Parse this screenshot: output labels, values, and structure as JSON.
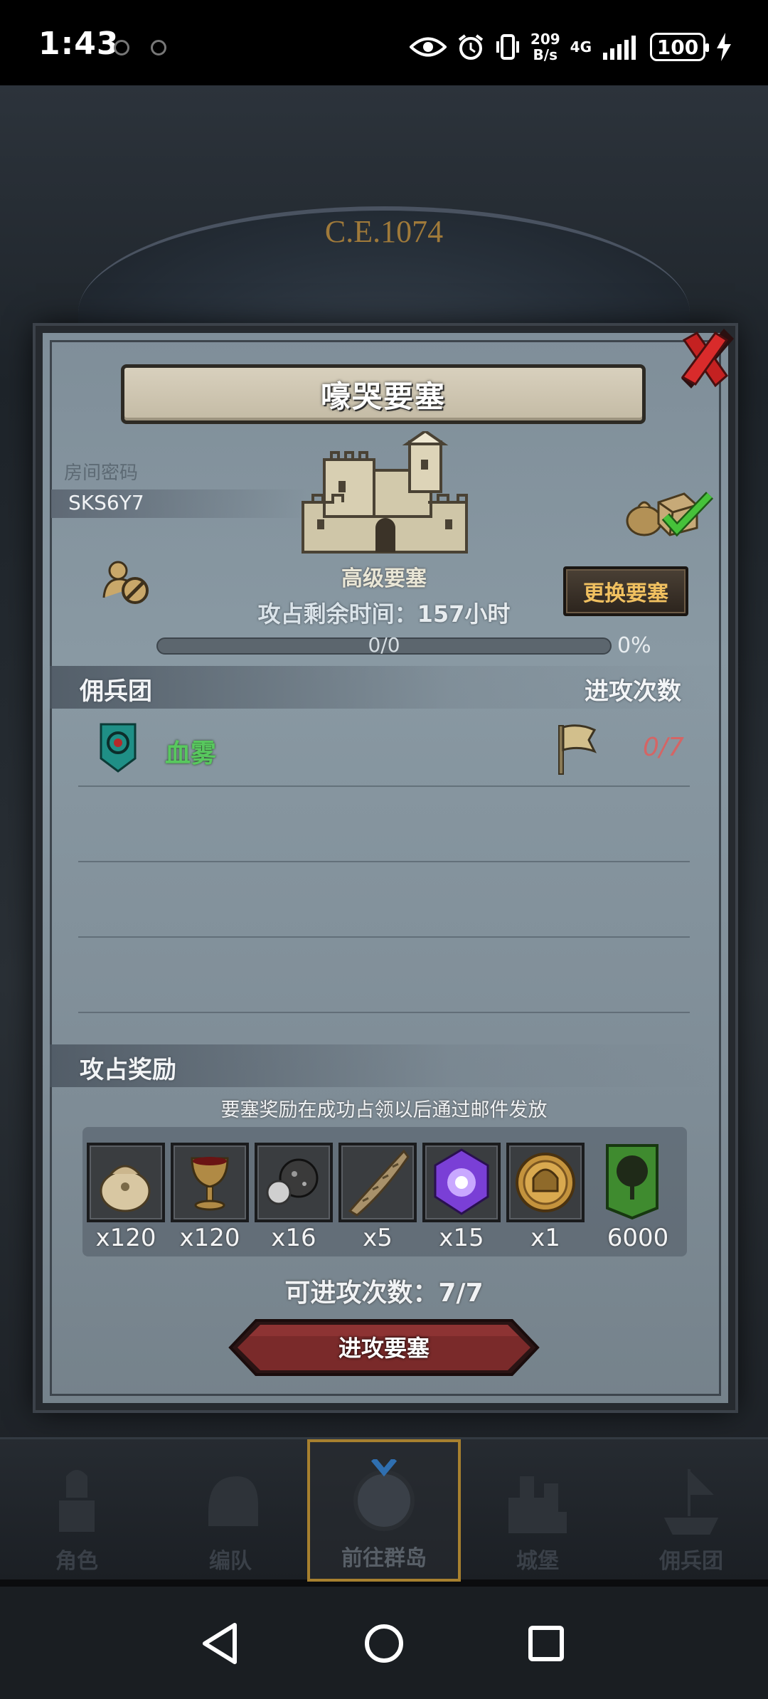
{
  "status_bar": {
    "time": "1:43",
    "net_speed_value": "209",
    "net_speed_unit": "B/s",
    "network": "4G",
    "battery": "100"
  },
  "background": {
    "year": "C.E.1074"
  },
  "dialog": {
    "title": "嚎哭要塞",
    "room_password_label": "房间密码",
    "room_password": "SKS6Y7",
    "fortress_level": "高级要塞",
    "change_fortress_label": "更换要塞",
    "occupy_time_label": "攻占剩余时间：",
    "occupy_time_value": "157",
    "occupy_time_unit": "小时",
    "progress_text": "0/0",
    "progress_percent_text": "0%",
    "progress_fraction": 0,
    "mercenary_section_label": "佣兵团",
    "attack_count_section_label": "进攻次数",
    "guilds": [
      {
        "name": "血雾",
        "attacks": "0/7"
      }
    ],
    "reward_section_label": "攻占奖励",
    "reward_note": "要塞奖励在成功占领以后通过邮件发放",
    "rewards": [
      {
        "icon": "sack-icon",
        "qty": "x120"
      },
      {
        "icon": "goblet-icon",
        "qty": "x120"
      },
      {
        "icon": "ore-icon",
        "qty": "x16"
      },
      {
        "icon": "horn-icon",
        "qty": "x5"
      },
      {
        "icon": "purple-crystal-icon",
        "qty": "x15"
      },
      {
        "icon": "helmet-coin-icon",
        "qty": "x1"
      },
      {
        "icon": "tree-banner-icon",
        "qty": "6000"
      }
    ],
    "attempts_label": "可进攻次数：",
    "attempts_value": "7/7",
    "attack_button_label": "进攻要塞"
  },
  "bottom_nav": {
    "items": [
      {
        "label": "角色",
        "icon": "knight-icon",
        "active": false
      },
      {
        "label": "编队",
        "icon": "helmet-icon",
        "active": false
      },
      {
        "label": "前往群岛",
        "icon": "globe-compass-icon",
        "active": true
      },
      {
        "label": "城堡",
        "icon": "castle-icon",
        "active": false
      },
      {
        "label": "佣兵团",
        "icon": "ship-icon",
        "active": false
      }
    ]
  },
  "colors": {
    "guild_name": "#58c85e",
    "attack_count": "#d46565",
    "change_button_text": "#f0c060",
    "accent_gold": "#a7802f"
  }
}
